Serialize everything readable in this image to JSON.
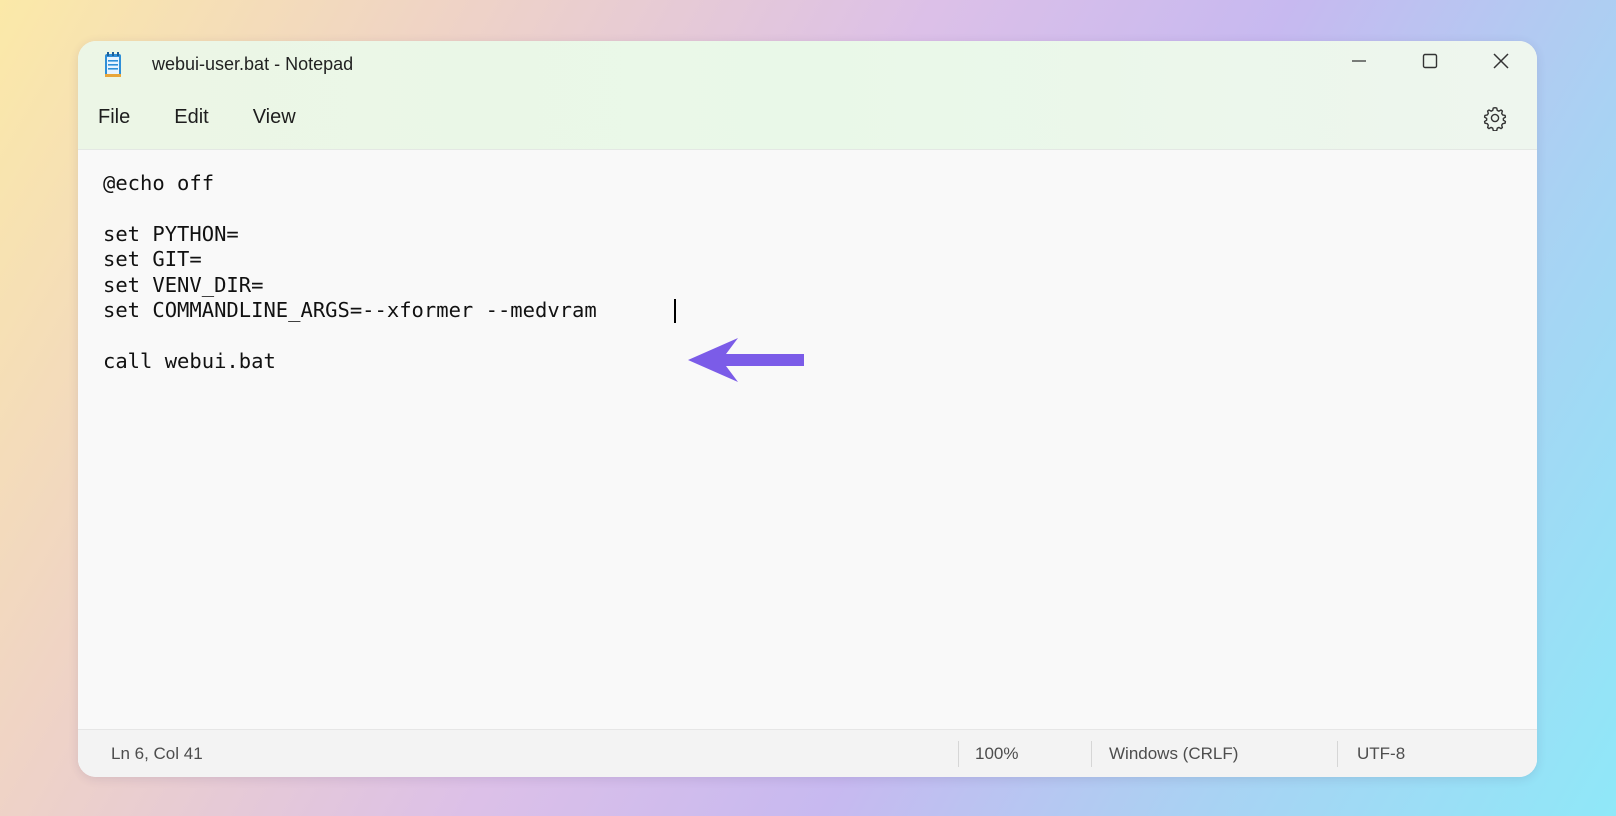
{
  "window": {
    "title": "webui-user.bat - Notepad",
    "app_icon": "notepad-icon"
  },
  "window_controls": {
    "minimize_icon": "minimize-icon",
    "maximize_icon": "maximize-icon",
    "close_icon": "close-icon"
  },
  "menu": {
    "items": [
      "File",
      "Edit",
      "View"
    ],
    "settings_icon": "gear-icon"
  },
  "editor": {
    "lines": [
      "@echo off",
      "",
      "set PYTHON=",
      "set GIT=",
      "set VENV_DIR=",
      "set COMMANDLINE_ARGS=--xformer --medvram",
      "",
      "call webui.bat"
    ]
  },
  "annotation": {
    "icon": "arrow-left-icon",
    "color": "#7b5ce8"
  },
  "status": {
    "position": "Ln 6, Col 41",
    "zoom": "100%",
    "line_ending": "Windows (CRLF)",
    "encoding": "UTF-8"
  }
}
